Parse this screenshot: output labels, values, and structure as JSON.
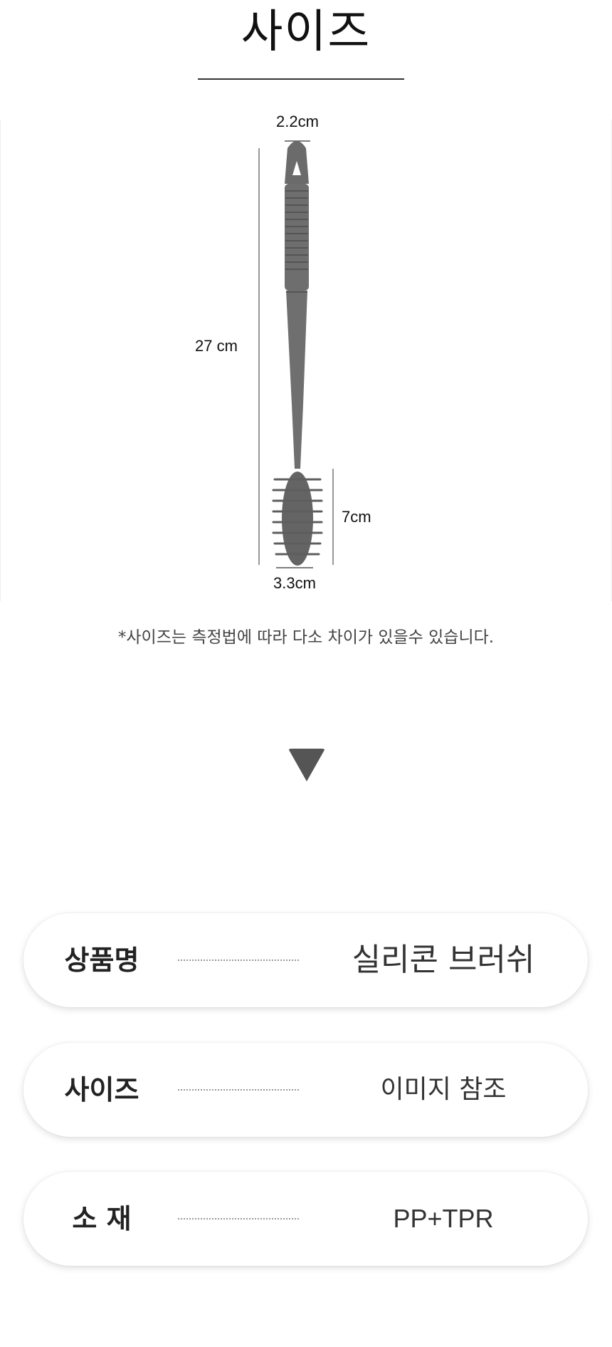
{
  "title": "사이즈",
  "dimensions": {
    "top_width": "2.2cm",
    "length": "27 cm",
    "head_length": "7cm",
    "head_width": "3.3cm"
  },
  "note": "*사이즈는 측정법에 따라 다소 차이가 있을수 있습니다.",
  "icons": {
    "arrow": "arrow-down-icon"
  },
  "specs": [
    {
      "label": "상품명",
      "value": "실리콘 브러쉬"
    },
    {
      "label": "사이즈",
      "value": "이미지 참조"
    },
    {
      "label": "소 재",
      "value": "PP+TPR"
    }
  ],
  "colors": {
    "brush": "#6b6b6b",
    "arrow": "#555555",
    "text": "#222222"
  }
}
